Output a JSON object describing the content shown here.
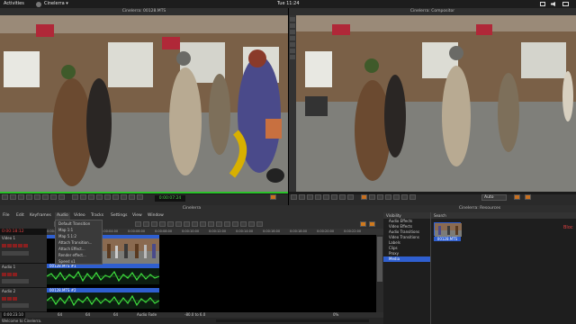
{
  "topbar": {
    "activities": "Activities",
    "app_menu": "Cinelerra ▾",
    "clock": "Tue 11:24"
  },
  "viewer": {
    "title": "Cinelerra: 00128.MTS",
    "timecode": "0:00:07:24"
  },
  "compositor": {
    "title": "Cinelerra: Compositor",
    "zoom": "Auto"
  },
  "program": {
    "title": "Cinelerra",
    "menu": [
      "File",
      "Edit",
      "Keyframes",
      "Audio",
      "Video",
      "Tracks",
      "Settings",
      "View",
      "Window"
    ],
    "position": "0:00:18:12",
    "status": "Welcome to Cinelerra.",
    "bottom_time": "0:00:23:10",
    "bottom_fields": [
      "64",
      "64",
      "64",
      "Audio Fade",
      "-80.0 to 6.0",
      "0%"
    ],
    "ruler": [
      "0:00:00:00",
      "0:00:02:00",
      "0:00:04:00",
      "0:00:06:00",
      "0:00:08:00",
      "0:00:10:00",
      "0:00:12:00",
      "0:00:14:00",
      "0:00:16:00",
      "0:00:18:00",
      "0:00:20:00",
      "0:00:22:00"
    ]
  },
  "audio_menu": {
    "items": [
      "Default Transition",
      "Map 1:1",
      "Map 5.1:2",
      "Attach Transition...",
      "Attach Effect...",
      "Render effect...",
      "Speed x1"
    ]
  },
  "tracks": [
    {
      "name": "Video 1",
      "clip": "00128.MTS"
    },
    {
      "name": "Audio 1",
      "clip": "00128.MTS #1"
    },
    {
      "name": "Audio 2",
      "clip": "00128.MTS #2"
    }
  ],
  "resources": {
    "title": "Cinelerra: Resources",
    "folders": [
      "Visibility",
      "Audio Effects",
      "Video Effects",
      "Audio Transitions",
      "Video Transitions",
      "Labels",
      "Clips",
      "Proxy",
      "Media"
    ],
    "selected_folder": "Media",
    "search_label": "Search",
    "asset_name": "00128.MTS"
  },
  "right_edge_label": "Bloc"
}
